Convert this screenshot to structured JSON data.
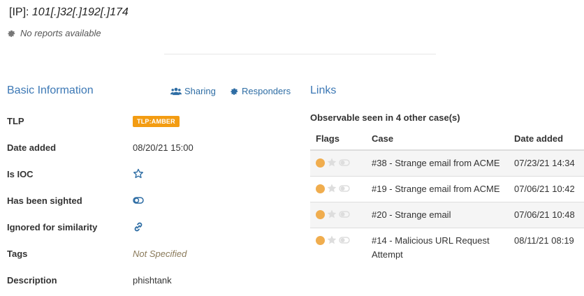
{
  "header": {
    "observable_type": "[IP]:",
    "observable_value": "101[.]32[.]192[.]174",
    "no_reports": "No reports available"
  },
  "basic": {
    "title": "Basic Information",
    "sharing_label": "Sharing",
    "responders_label": "Responders",
    "rows": {
      "tlp": {
        "label": "TLP",
        "value": "TLP:AMBER"
      },
      "date_added": {
        "label": "Date added",
        "value": "08/20/21 15:00"
      },
      "is_ioc": {
        "label": "Is IOC"
      },
      "sighted": {
        "label": "Has been sighted"
      },
      "ignored": {
        "label": "Ignored for similarity"
      },
      "tags": {
        "label": "Tags",
        "value": "Not Specified"
      },
      "description": {
        "label": "Description",
        "value": "phishtank"
      }
    }
  },
  "links": {
    "title": "Links",
    "subtitle": "Observable seen in 4 other case(s)",
    "columns": {
      "flags": "Flags",
      "case": "Case",
      "date": "Date added"
    },
    "rows": [
      {
        "case": "#38 - Strange email from ACME",
        "date": "07/23/21 14:34"
      },
      {
        "case": "#19 - Strange email from ACME",
        "date": "07/06/21 10:42"
      },
      {
        "case": "#20 - Strange email",
        "date": "07/06/21 10:48"
      },
      {
        "case": "#14 - Malicious URL Request Attempt",
        "date": "08/11/21 08:19"
      }
    ]
  },
  "colors": {
    "accent": "#3c78b5",
    "tlp_amber": "#f39c12",
    "flag_dot": "#f0ad4e"
  },
  "icons": [
    "gear-icon",
    "users-icon",
    "star-outline-icon",
    "toggle-icon",
    "link-icon",
    "star-icon"
  ]
}
